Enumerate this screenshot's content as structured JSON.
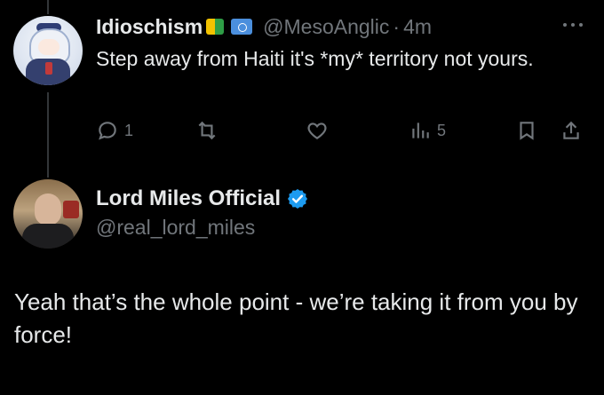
{
  "tweet1": {
    "display_name": "Idioschism",
    "handle": "@MesoAnglic",
    "separator": "·",
    "time": "4m",
    "text": "Step away from Haiti it's *my* territory not yours.",
    "actions": {
      "reply_count": "1",
      "retweet_count": "",
      "like_count": "",
      "views_count": "5"
    },
    "badges": [
      "beginner-leaf-icon",
      "united-nations-flag-icon"
    ]
  },
  "tweet2": {
    "display_name": "Lord Miles Official",
    "handle": "@real_lord_miles",
    "text": "Yeah that’s the whole point - we’re taking it from you by force!",
    "verified": true
  },
  "colors": {
    "background": "#000000",
    "primary_text": "#e7e9ea",
    "secondary_text": "#71767b",
    "verified_blue": "#1d9bf0",
    "thread_line": "#333639"
  }
}
